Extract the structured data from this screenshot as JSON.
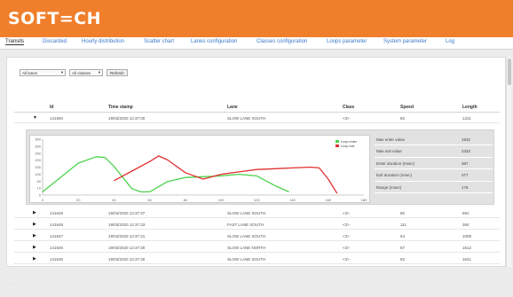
{
  "app": {
    "logo": "SOFT=CH"
  },
  "tabs": [
    {
      "label": "Transits",
      "active": true
    },
    {
      "label": "Discarded",
      "active": false
    },
    {
      "label": "Hourly distribution",
      "active": false
    },
    {
      "label": "Scatter chart",
      "active": false
    },
    {
      "label": "Lanes configuration",
      "active": false
    },
    {
      "label": "Classes configuration",
      "active": false
    },
    {
      "label": "Loops parameter",
      "active": false
    },
    {
      "label": "System parameter",
      "active": false
    },
    {
      "label": "Log",
      "active": false
    }
  ],
  "filters": {
    "lanes": "All lanes",
    "classes": "All classes",
    "refresh": "Refresh"
  },
  "table": {
    "headers": [
      "Id",
      "Time stamp",
      "Lane",
      "Class",
      "Speed",
      "Length"
    ],
    "expanded_row": {
      "id": "141650",
      "time": "19/03/2020 12:37:00",
      "lane": "SLOW LANE SOUTH",
      "class": "<3>",
      "speed": "80",
      "length": "1311"
    },
    "rows": [
      {
        "id": "141649",
        "time": "19/03/2020 12:37:37",
        "lane": "SLOW LANE SOUTH",
        "class": "<3>",
        "speed": "80",
        "length": "891"
      },
      {
        "id": "141648",
        "time": "19/03/2020 12:37:33",
        "lane": "FAST LANE SOUTH",
        "class": "<3>",
        "speed": "111",
        "length": "384"
      },
      {
        "id": "141647",
        "time": "19/03/2020 12:37:31",
        "lane": "SLOW LANE SOUTH",
        "class": "<3>",
        "speed": "54",
        "length": "1009"
      },
      {
        "id": "141646",
        "time": "19/03/2020 12:37:30",
        "lane": "SLOW LANE NORTH",
        "class": "<3>",
        "speed": "87",
        "length": "1612"
      },
      {
        "id": "141645",
        "time": "19/03/2020 12:37:30",
        "lane": "SLOW LANE SOUTH",
        "class": "<3>",
        "speed": "82",
        "length": "1641"
      }
    ]
  },
  "detail_stats": [
    {
      "label": "Max enter value",
      "value": "1932"
    },
    {
      "label": "Max exit value",
      "value": "2332"
    },
    {
      "label": "Enter duration (msec)",
      "value": "387"
    },
    {
      "label": "Exit duration (msec)",
      "value": "377"
    },
    {
      "label": "Range (msec)",
      "value": "176"
    }
  ],
  "chart_data": {
    "type": "line",
    "legend_position": "top-right",
    "ylim": [
      0,
      350
    ],
    "xlim": [
      0,
      180
    ],
    "y_ticks": [
      "0",
      "10",
      "50",
      "100",
      "150",
      "200",
      "250",
      "300",
      "350"
    ],
    "x_ticks": [
      "0",
      "20",
      "40",
      "60",
      "80",
      "100",
      "120",
      "140",
      "160",
      "180"
    ],
    "series": [
      {
        "name": "Loop enter",
        "color": "#4bd24b",
        "x": [
          0,
          10,
          20,
          30,
          35,
          40,
          50,
          55,
          60,
          70,
          80,
          90,
          100,
          110,
          120,
          130,
          138
        ],
        "y": [
          20,
          110,
          200,
          240,
          235,
          180,
          40,
          20,
          20,
          85,
          110,
          115,
          120,
          130,
          120,
          60,
          20
        ]
      },
      {
        "name": "Loop exit",
        "color": "#e03030",
        "x": [
          40,
          50,
          60,
          65,
          70,
          80,
          90,
          100,
          110,
          120,
          130,
          140,
          150,
          155,
          160,
          165
        ],
        "y": [
          90,
          150,
          210,
          245,
          220,
          140,
          100,
          130,
          145,
          160,
          165,
          170,
          175,
          170,
          100,
          10
        ]
      }
    ]
  },
  "footer": "·  ·  ·"
}
